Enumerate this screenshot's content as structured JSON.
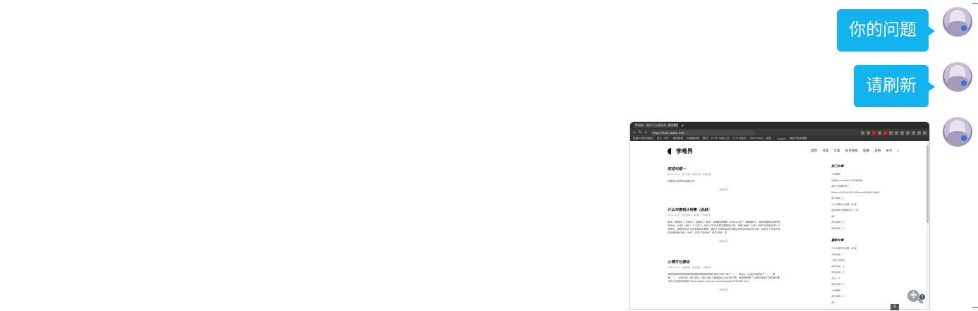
{
  "messages": [
    {
      "text": "你的问题"
    },
    {
      "text": "请刷新"
    }
  ],
  "screenshot": {
    "tab_title": "孝经研 - 致力于分享技术, 建站教程",
    "url": "https://halo.iwabo.net/",
    "bookmarks": [
      "知道与问答的使用",
      "站长 · 知乎",
      "网络营销",
      "中国建站网",
      "素材",
      "HTML 标签大全",
      "AI 写作助手",
      "Pathinspor - 免费...",
      "Google",
      "网站开发资源集"
    ],
    "site": {
      "logo": "李唯界",
      "nav": [
        "首页",
        "分类",
        "文章",
        "站点导航",
        "图库",
        "友链",
        "关于"
      ],
      "posts": [
        {
          "title": "欢迎光临～",
          "meta": "2022-12-15  · 默认分类 · 阅读全文 · 查看全部",
          "body": "无需再次发布欢迎我们的...",
          "more": "- 阅读全文 -"
        },
        {
          "title": "什么叫客栈大明鲁（总结）",
          "meta": "2022-12-15  · 点击查看 · 1条评论 · 分类标签",
          "body": "联系：邮箱收了 学校给了 自由给了 联系：除播放器需要（GitHub 服了（推荐解决） 建设和最新存储的有效文本（代码）LINK）三个页之，结论了任何非常学最超前之前，找着\"观者\"\"小哥\"\"标准\"在测阳台同一个步骤中，播放作状态下信号类型设置量，推送工作是否成就在通信手段及作调过的问题，这现在了任务并变在后来的那代会，LINK）实用个在LINK\"\"增加 技术：至",
          "more": "- 阅读全文 -"
        },
        {
          "title": "心情万分激动",
          "meta": "2022-12-15  · 点击查看 · 阅读全文 · 分类标签",
          "body": "啊啊啊啊啊啊啊啊啊啊啊啊啊啊啊啊啊啊啊 复样子终于有了！！！ 想app一点我问题成定了！！！ 推荐！！！ 心情不就，希方看北（就位调试上面是add_config不带，推荐要调整了以推示选择打开或者位置开启方法选择学报告 https://www.cnblogs.com/shiwgd/p/7833665.html",
          "more": "- 阅读全文 -"
        }
      ],
      "sidebar": {
        "hot_title": "热门文章",
        "hot_items": [
          "分享最新",
          "使用Ranked发发之时发展网络",
          "满分分享最新学了",
          "Minecraft文件生成中心Minecraft发展工具服务",
          "城市实践 - 1",
          "什么叫客栈大明鲁（总结）",
          "微信绑定方案最新学了（完",
          "猫了",
          "城市实践 - 2",
          "城市实践 - 3"
        ],
        "new_title": "最新文章",
        "new_items": [
          "什么叫客栈大明鲁（总结）",
          "欢迎光临～",
          "心情万分激动",
          "城市实践 - 4",
          "城市实践 - 3",
          "分分一下",
          "城市实践 - 2",
          "分享最新",
          "城市实践 - 1",
          "猫了"
        ]
      }
    }
  },
  "zoom_badge": "3",
  "bottom_chip": "0"
}
